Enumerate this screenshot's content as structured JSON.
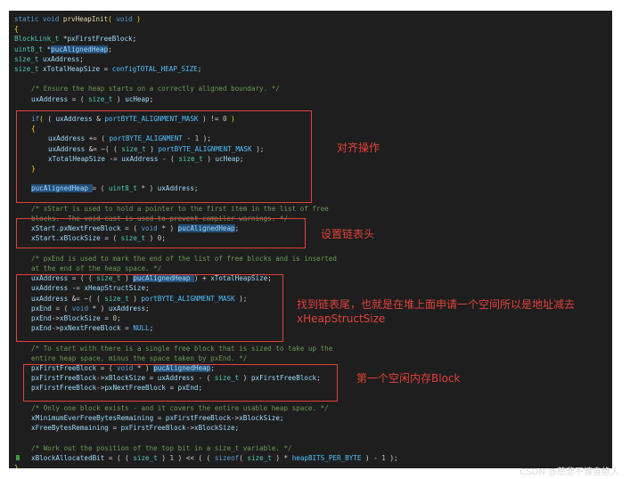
{
  "code": {
    "lines": [
      {
        "indent": 0,
        "tokens": [
          [
            "kw",
            "static "
          ],
          [
            "kw",
            "void "
          ],
          [
            "fn",
            "prvHeapInit"
          ],
          [
            "br",
            "( "
          ],
          [
            "kw",
            "void "
          ],
          [
            "br",
            ")"
          ]
        ]
      },
      {
        "indent": 0,
        "tokens": [
          [
            "br",
            "{"
          ]
        ]
      },
      {
        "indent": 0,
        "tokens": [
          [
            "ty",
            "BlockLink_t "
          ],
          [
            "pl",
            "*"
          ],
          [
            "id",
            "pxFirstFreeBlock"
          ],
          [
            "pl",
            ";"
          ]
        ]
      },
      {
        "indent": 0,
        "tokens": [
          [
            "ty",
            "uint8_t "
          ],
          [
            "pl",
            "*"
          ],
          [
            "hl",
            "pucAlignedHeap"
          ],
          [
            "pl",
            ";"
          ]
        ]
      },
      {
        "indent": 0,
        "tokens": [
          [
            "ty",
            "size_t "
          ],
          [
            "id",
            "uxAddress"
          ],
          [
            "pl",
            ";"
          ]
        ]
      },
      {
        "indent": 0,
        "tokens": [
          [
            "ty",
            "size_t "
          ],
          [
            "id",
            "xTotalHeapSize "
          ],
          [
            "pl",
            "= "
          ],
          [
            "mc",
            "configTOTAL_HEAP_SIZE"
          ],
          [
            "pl",
            ";"
          ]
        ]
      },
      {
        "indent": 0,
        "tokens": []
      },
      {
        "indent": 1,
        "tokens": [
          [
            "cm",
            "/* Ensure the heap starts on a correctly aligned boundary. */"
          ]
        ]
      },
      {
        "indent": 1,
        "tokens": [
          [
            "id",
            "uxAddress "
          ],
          [
            "pl",
            "= ( "
          ],
          [
            "ty",
            "size_t "
          ],
          [
            "pl",
            ") "
          ],
          [
            "id",
            "ucHeap"
          ],
          [
            "pl",
            ";"
          ]
        ]
      },
      {
        "indent": 0,
        "tokens": []
      },
      {
        "indent": 1,
        "tokens": [
          [
            "kw",
            "if"
          ],
          [
            "br",
            "( "
          ],
          [
            "pl",
            "( "
          ],
          [
            "id",
            "uxAddress "
          ],
          [
            "pl",
            "& "
          ],
          [
            "mc",
            "portBYTE_ALIGNMENT_MASK "
          ],
          [
            "pl",
            ") != "
          ],
          [
            "num",
            "0 "
          ],
          [
            "br",
            ")"
          ]
        ]
      },
      {
        "indent": 1,
        "tokens": [
          [
            "br",
            "{"
          ]
        ]
      },
      {
        "indent": 2,
        "tokens": [
          [
            "id",
            "uxAddress "
          ],
          [
            "pl",
            "+= ( "
          ],
          [
            "mc",
            "portBYTE_ALIGNMENT "
          ],
          [
            "pl",
            "- "
          ],
          [
            "num",
            "1 "
          ],
          [
            "pl",
            ");"
          ]
        ]
      },
      {
        "indent": 2,
        "tokens": [
          [
            "id",
            "uxAddress "
          ],
          [
            "pl",
            "&= ~( ( "
          ],
          [
            "ty",
            "size_t "
          ],
          [
            "pl",
            ") "
          ],
          [
            "mc",
            "portBYTE_ALIGNMENT_MASK "
          ],
          [
            "pl",
            ");"
          ]
        ]
      },
      {
        "indent": 2,
        "tokens": [
          [
            "id",
            "xTotalHeapSize "
          ],
          [
            "pl",
            "-= "
          ],
          [
            "id",
            "uxAddress "
          ],
          [
            "pl",
            "- ( "
          ],
          [
            "ty",
            "size_t "
          ],
          [
            "pl",
            ") "
          ],
          [
            "id",
            "ucHeap"
          ],
          [
            "pl",
            ";"
          ]
        ]
      },
      {
        "indent": 1,
        "tokens": [
          [
            "br",
            "}"
          ]
        ]
      },
      {
        "indent": 0,
        "tokens": []
      },
      {
        "indent": 1,
        "tokens": [
          [
            "hl",
            "pucAlignedHeap "
          ],
          [
            "pl",
            "= ( "
          ],
          [
            "ty",
            "uint8_t "
          ],
          [
            "pl",
            "* ) "
          ],
          [
            "id",
            "uxAddress"
          ],
          [
            "pl",
            ";"
          ]
        ]
      },
      {
        "indent": 0,
        "tokens": []
      },
      {
        "indent": 1,
        "tokens": [
          [
            "cm",
            "/* xStart is used to hold a pointer to the first item in the list of free"
          ]
        ]
      },
      {
        "indent": 1,
        "tokens": [
          [
            "cm",
            "blocks.  The void cast is used to prevent compiler warnings. */"
          ]
        ]
      },
      {
        "indent": 1,
        "tokens": [
          [
            "id",
            "xStart"
          ],
          [
            "pl",
            "."
          ],
          [
            "id",
            "pxNextFreeBlock "
          ],
          [
            "pl",
            "= ( "
          ],
          [
            "kw",
            "void "
          ],
          [
            "pl",
            "* ) "
          ],
          [
            "hl",
            "pucAlignedHeap"
          ],
          [
            "pl",
            ";"
          ]
        ]
      },
      {
        "indent": 1,
        "tokens": [
          [
            "id",
            "xStart"
          ],
          [
            "pl",
            "."
          ],
          [
            "id",
            "xBlockSize "
          ],
          [
            "pl",
            "= ( "
          ],
          [
            "ty",
            "size_t "
          ],
          [
            "pl",
            ") "
          ],
          [
            "num",
            "0"
          ],
          [
            "pl",
            ";"
          ]
        ]
      },
      {
        "indent": 0,
        "tokens": []
      },
      {
        "indent": 1,
        "tokens": [
          [
            "cm",
            "/* pxEnd is used to mark the end of the list of free blocks and is inserted"
          ]
        ]
      },
      {
        "indent": 1,
        "tokens": [
          [
            "cm",
            "at the end of the heap space. */"
          ]
        ]
      },
      {
        "indent": 1,
        "tokens": [
          [
            "id",
            "uxAddress "
          ],
          [
            "pl",
            "= ( ( "
          ],
          [
            "ty",
            "size_t "
          ],
          [
            "pl",
            ") "
          ],
          [
            "hl",
            "pucAlignedHeap "
          ],
          [
            "pl",
            ") + "
          ],
          [
            "id",
            "xTotalHeapSize"
          ],
          [
            "pl",
            ";"
          ]
        ]
      },
      {
        "indent": 1,
        "tokens": [
          [
            "id",
            "uxAddress "
          ],
          [
            "pl",
            "-= "
          ],
          [
            "id",
            "xHeapStructSize"
          ],
          [
            "pl",
            ";"
          ]
        ]
      },
      {
        "indent": 1,
        "tokens": [
          [
            "id",
            "uxAddress "
          ],
          [
            "pl",
            "&= ~( ( "
          ],
          [
            "ty",
            "size_t "
          ],
          [
            "pl",
            ") "
          ],
          [
            "mc",
            "portBYTE_ALIGNMENT_MASK "
          ],
          [
            "pl",
            ");"
          ]
        ]
      },
      {
        "indent": 1,
        "tokens": [
          [
            "id",
            "pxEnd "
          ],
          [
            "pl",
            "= ( "
          ],
          [
            "kw",
            "void "
          ],
          [
            "pl",
            "* ) "
          ],
          [
            "id",
            "uxAddress"
          ],
          [
            "pl",
            ";"
          ]
        ]
      },
      {
        "indent": 1,
        "tokens": [
          [
            "id",
            "pxEnd"
          ],
          [
            "pl",
            "->"
          ],
          [
            "id",
            "xBlockSize "
          ],
          [
            "pl",
            "= "
          ],
          [
            "num",
            "0"
          ],
          [
            "pl",
            ";"
          ]
        ]
      },
      {
        "indent": 1,
        "tokens": [
          [
            "id",
            "pxEnd"
          ],
          [
            "pl",
            "->"
          ],
          [
            "id",
            "pxNextFreeBlock "
          ],
          [
            "pl",
            "= "
          ],
          [
            "mc",
            "NULL"
          ],
          [
            "pl",
            ";"
          ]
        ]
      },
      {
        "indent": 0,
        "tokens": []
      },
      {
        "indent": 1,
        "tokens": [
          [
            "cm",
            "/* To start with there is a single free block that is sized to take up the"
          ]
        ]
      },
      {
        "indent": 1,
        "tokens": [
          [
            "cm",
            "entire heap space, minus the space taken by pxEnd. */"
          ]
        ]
      },
      {
        "indent": 1,
        "tokens": [
          [
            "id",
            "pxFirstFreeBlock "
          ],
          [
            "pl",
            "= ( "
          ],
          [
            "kw",
            "void "
          ],
          [
            "pl",
            "* ) "
          ],
          [
            "hl",
            "pucAlignedHeap"
          ],
          [
            "pl",
            ";"
          ]
        ]
      },
      {
        "indent": 1,
        "tokens": [
          [
            "id",
            "pxFirstFreeBlock"
          ],
          [
            "pl",
            "->"
          ],
          [
            "id",
            "xBlockSize "
          ],
          [
            "pl",
            "= "
          ],
          [
            "id",
            "uxAddress "
          ],
          [
            "pl",
            "- ( "
          ],
          [
            "ty",
            "size_t "
          ],
          [
            "pl",
            ") "
          ],
          [
            "id",
            "pxFirstFreeBlock"
          ],
          [
            "pl",
            ";"
          ]
        ]
      },
      {
        "indent": 1,
        "tokens": [
          [
            "id",
            "pxFirstFreeBlock"
          ],
          [
            "pl",
            "->"
          ],
          [
            "id",
            "pxNextFreeBlock "
          ],
          [
            "pl",
            "= "
          ],
          [
            "id",
            "pxEnd"
          ],
          [
            "pl",
            ";"
          ]
        ]
      },
      {
        "indent": 0,
        "tokens": []
      },
      {
        "indent": 1,
        "tokens": [
          [
            "cm",
            "/* Only one block exists - and it covers the entire usable heap space. */"
          ]
        ]
      },
      {
        "indent": 1,
        "tokens": [
          [
            "id",
            "xMinimumEverFreeBytesRemaining "
          ],
          [
            "pl",
            "= "
          ],
          [
            "id",
            "pxFirstFreeBlock"
          ],
          [
            "pl",
            "->"
          ],
          [
            "id",
            "xBlockSize"
          ],
          [
            "pl",
            ";"
          ]
        ]
      },
      {
        "indent": 1,
        "tokens": [
          [
            "id",
            "xFreeBytesRemaining "
          ],
          [
            "pl",
            "= "
          ],
          [
            "id",
            "pxFirstFreeBlock"
          ],
          [
            "pl",
            "->"
          ],
          [
            "id",
            "xBlockSize"
          ],
          [
            "pl",
            ";"
          ]
        ]
      },
      {
        "indent": 0,
        "tokens": []
      },
      {
        "indent": 1,
        "tokens": [
          [
            "cm",
            "/* Work out the position of the top bit in a size_t variable. */"
          ]
        ]
      },
      {
        "indent": 1,
        "tokens": [
          [
            "id",
            "xBlockAllocatedBit "
          ],
          [
            "pl",
            "= ( ( "
          ],
          [
            "ty",
            "size_t "
          ],
          [
            "pl",
            ") "
          ],
          [
            "num",
            "1 "
          ],
          [
            "pl",
            ") << ( ( "
          ],
          [
            "kw",
            "sizeof"
          ],
          [
            "pl",
            "( "
          ],
          [
            "ty",
            "size_t "
          ],
          [
            "pl",
            ") * "
          ],
          [
            "mc",
            "heapBITS_PER_BYTE "
          ],
          [
            "pl",
            ") - "
          ],
          [
            "num",
            "1 "
          ],
          [
            "pl",
            ");"
          ]
        ]
      },
      {
        "indent": 0,
        "tokens": [
          [
            "br",
            "}"
          ]
        ]
      }
    ]
  },
  "annotations": {
    "align": "对齐操作",
    "set_head": "设置链表头",
    "find_tail_line1": "找到链表尾，也就是在堆上面申请一个空间所以是地址减去",
    "find_tail_line2": "xHeapStructSize",
    "first_free": "第一个空闲内存Block"
  },
  "watermark": "CSDN @慈悲不渡自绝人",
  "colors": {
    "editor_bg": "#1e1e1e",
    "annotation_red": "#e0413a",
    "keyword": "#569cd6",
    "type": "#4ec9b0",
    "identifier": "#9cdcfe",
    "comment": "#6a9955",
    "number": "#b5cea8"
  }
}
